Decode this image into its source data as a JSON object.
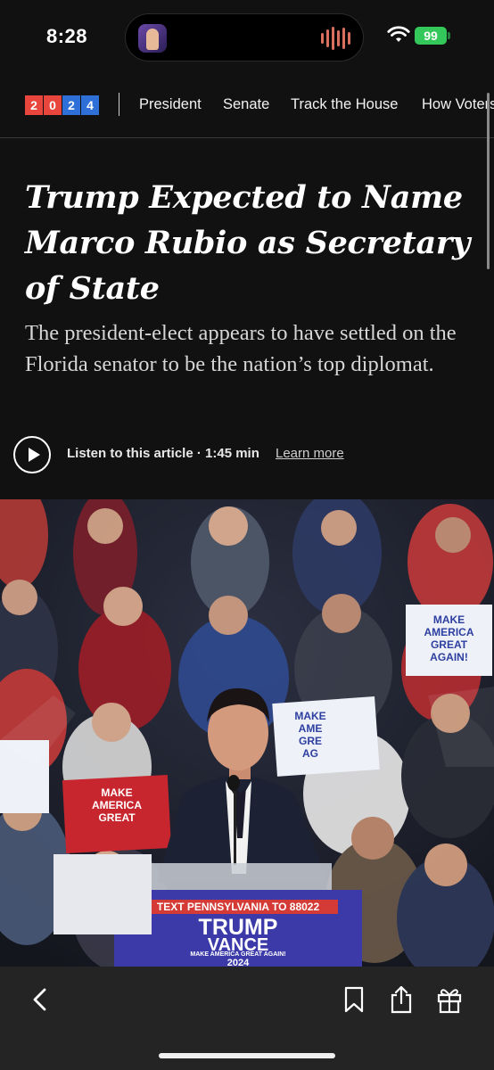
{
  "status_bar": {
    "time": "8:28",
    "battery": "99",
    "wifi_icon": "wifi-icon",
    "now_playing_icon": "now-playing-art-icon",
    "waveform_icon": "audio-waveform-icon"
  },
  "nav": {
    "logo_digits": [
      "2",
      "0",
      "2",
      "4"
    ],
    "logo_colors": [
      "#e8453c",
      "#e8453c",
      "#2e6fd8",
      "#2e6fd8"
    ],
    "items": [
      {
        "label": "President"
      },
      {
        "label": "Senate"
      },
      {
        "label": "Track the House"
      },
      {
        "label": "How Voters"
      }
    ]
  },
  "article": {
    "headline": "Trump Expected to Name Marco Rubio as Secretary of State",
    "summary": "The president-elect appears to have settled on the Florida senator to be the nation’s top diplomat.",
    "listen_label": "Listen to this article · 1:45 min",
    "learn_more": "Learn more",
    "play_icon": "play-icon"
  },
  "photo": {
    "podium_text_line": "TEXT PENNSYLVANIA TO 88022",
    "podium_name_1": "TRUMP",
    "podium_name_2": "VANCE",
    "podium_slogan": "MAKE AMERICA GREAT AGAIN!",
    "podium_year": "2024",
    "sign_right": "MAKE\nAMERICA\nGREAT\nAGAIN!",
    "sign_left": "MAKE\nAMERICA\nGREAT",
    "sign_center": "MAKE\nAME\nGRE\nAG"
  },
  "toolbar": {
    "back_icon": "chevron-left-icon",
    "bookmark_icon": "bookmark-icon",
    "share_icon": "share-icon",
    "gift_icon": "gift-icon"
  },
  "colors": {
    "background": "#111111",
    "toolbar": "#242424",
    "podium_blue": "#3b3aa8",
    "battery_green": "#34c759"
  }
}
